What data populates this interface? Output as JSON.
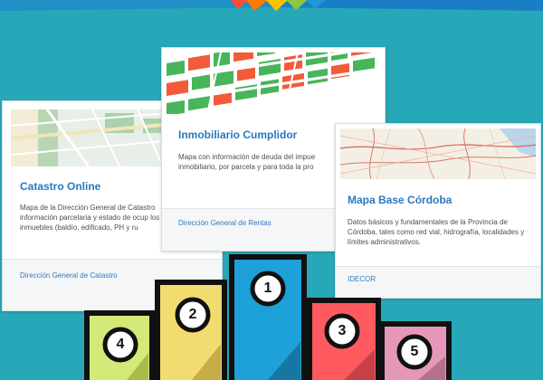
{
  "cards": [
    {
      "title": "Catastro Online",
      "description": "Mapa de la Dirección General de Catastro información parcelaria y estado de ocup los inmuebles (baldío, edificado, PH y ru",
      "link": "Dirección General de Catastro"
    },
    {
      "title": "Inmobiliario Cumplidor",
      "description": "Mapa con información de deuda del impue inmobiliario, por parcela y para toda la pro",
      "link": "Dirección General de Rentas"
    },
    {
      "title": "Mapa Base Córdoba",
      "description": "Datos básicos y fundamentales de la Provincia de Córdoba, tales como red vial, hidrografía, localidades y límites administrativos.",
      "link": "IDECOR"
    }
  ],
  "podium": {
    "ranks": [
      "1",
      "2",
      "3",
      "4",
      "5"
    ]
  },
  "colors": {
    "background": "#27a8b8",
    "card_title": "#2a78bf",
    "rank_1": "#1ea0d8",
    "rank_2": "#f2dc6f",
    "rank_3": "#ff5a5f",
    "rank_4": "#d4ea78",
    "rank_5": "#e497b8"
  }
}
